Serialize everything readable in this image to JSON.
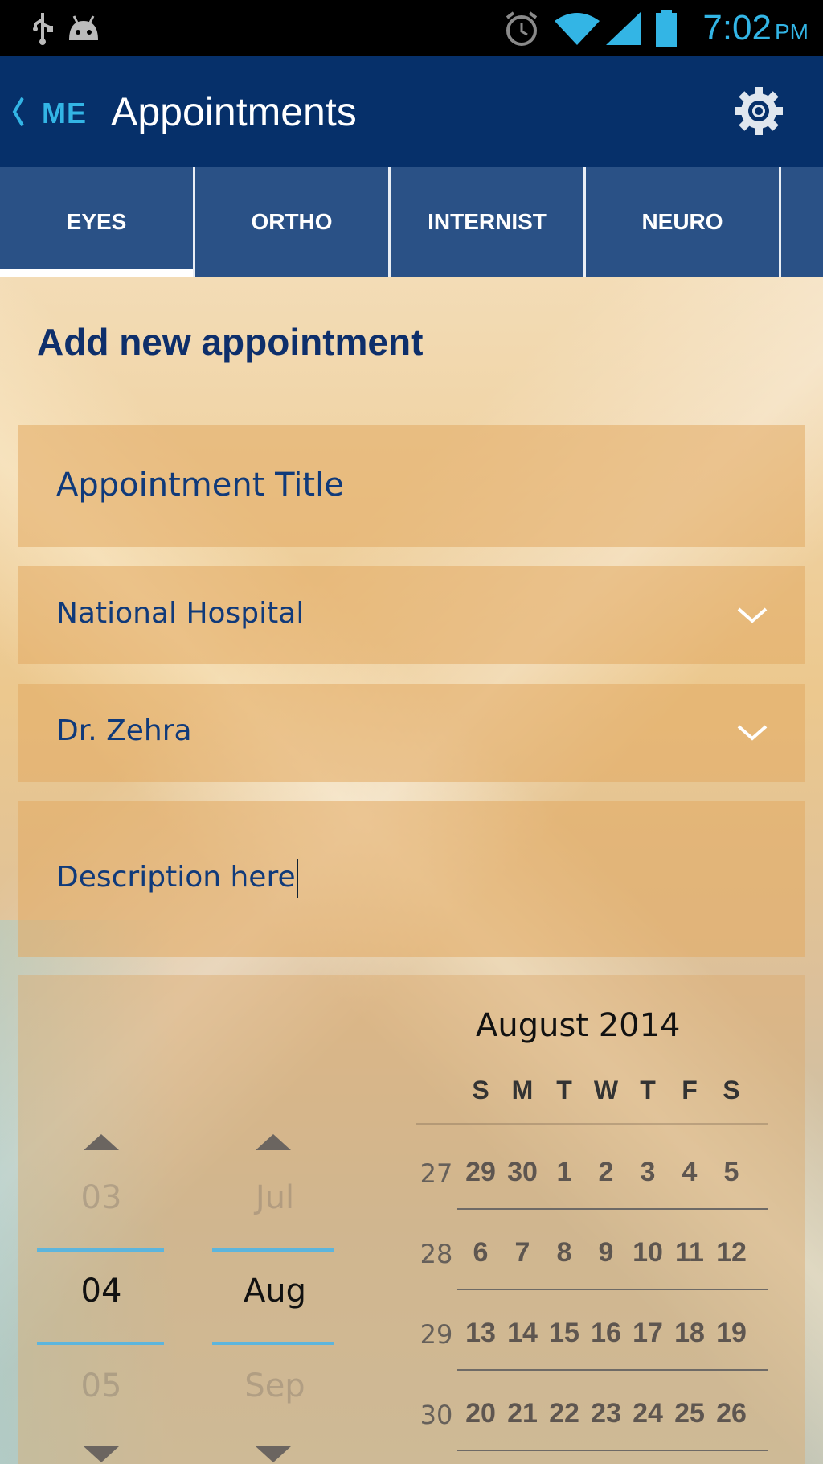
{
  "status_bar": {
    "time": "7:02",
    "ampm": "PM",
    "icons": [
      "usb-icon",
      "android-debug-icon",
      "alarm-icon",
      "wifi-icon",
      "signal-icon",
      "battery-icon"
    ]
  },
  "action_bar": {
    "back_label": "ME",
    "title": "Appointments",
    "settings_icon": "gear-icon"
  },
  "tabs": [
    {
      "label": "EYES",
      "selected": true
    },
    {
      "label": "ORTHO",
      "selected": false
    },
    {
      "label": "INTERNIST",
      "selected": false
    },
    {
      "label": "NEURO",
      "selected": false
    }
  ],
  "form": {
    "heading": "Add new appointment",
    "title_placeholder": "Appointment Title",
    "hospital_value": "National Hospital",
    "doctor_value": "Dr. Zehra",
    "description_value": "Description here"
  },
  "date_picker": {
    "day": {
      "prev": "03",
      "current": "04",
      "next": "05"
    },
    "month": {
      "prev": "Jul",
      "current": "Aug",
      "next": "Sep"
    }
  },
  "calendar": {
    "title": "August 2014",
    "weekdays": [
      "S",
      "M",
      "T",
      "W",
      "T",
      "F",
      "S"
    ],
    "weeks": [
      {
        "week": "27",
        "days": [
          "29",
          "30",
          "1",
          "2",
          "3",
          "4",
          "5"
        ]
      },
      {
        "week": "28",
        "days": [
          "6",
          "7",
          "8",
          "9",
          "10",
          "11",
          "12"
        ]
      },
      {
        "week": "29",
        "days": [
          "13",
          "14",
          "15",
          "16",
          "17",
          "18",
          "19"
        ]
      },
      {
        "week": "30",
        "days": [
          "20",
          "21",
          "22",
          "23",
          "24",
          "25",
          "26"
        ]
      }
    ]
  },
  "colors": {
    "status_bar": "#000000",
    "action_bar": "#06306a",
    "tab_bar": "#2a5186",
    "accent": "#33b5e5",
    "text_blue": "#103a7a"
  }
}
